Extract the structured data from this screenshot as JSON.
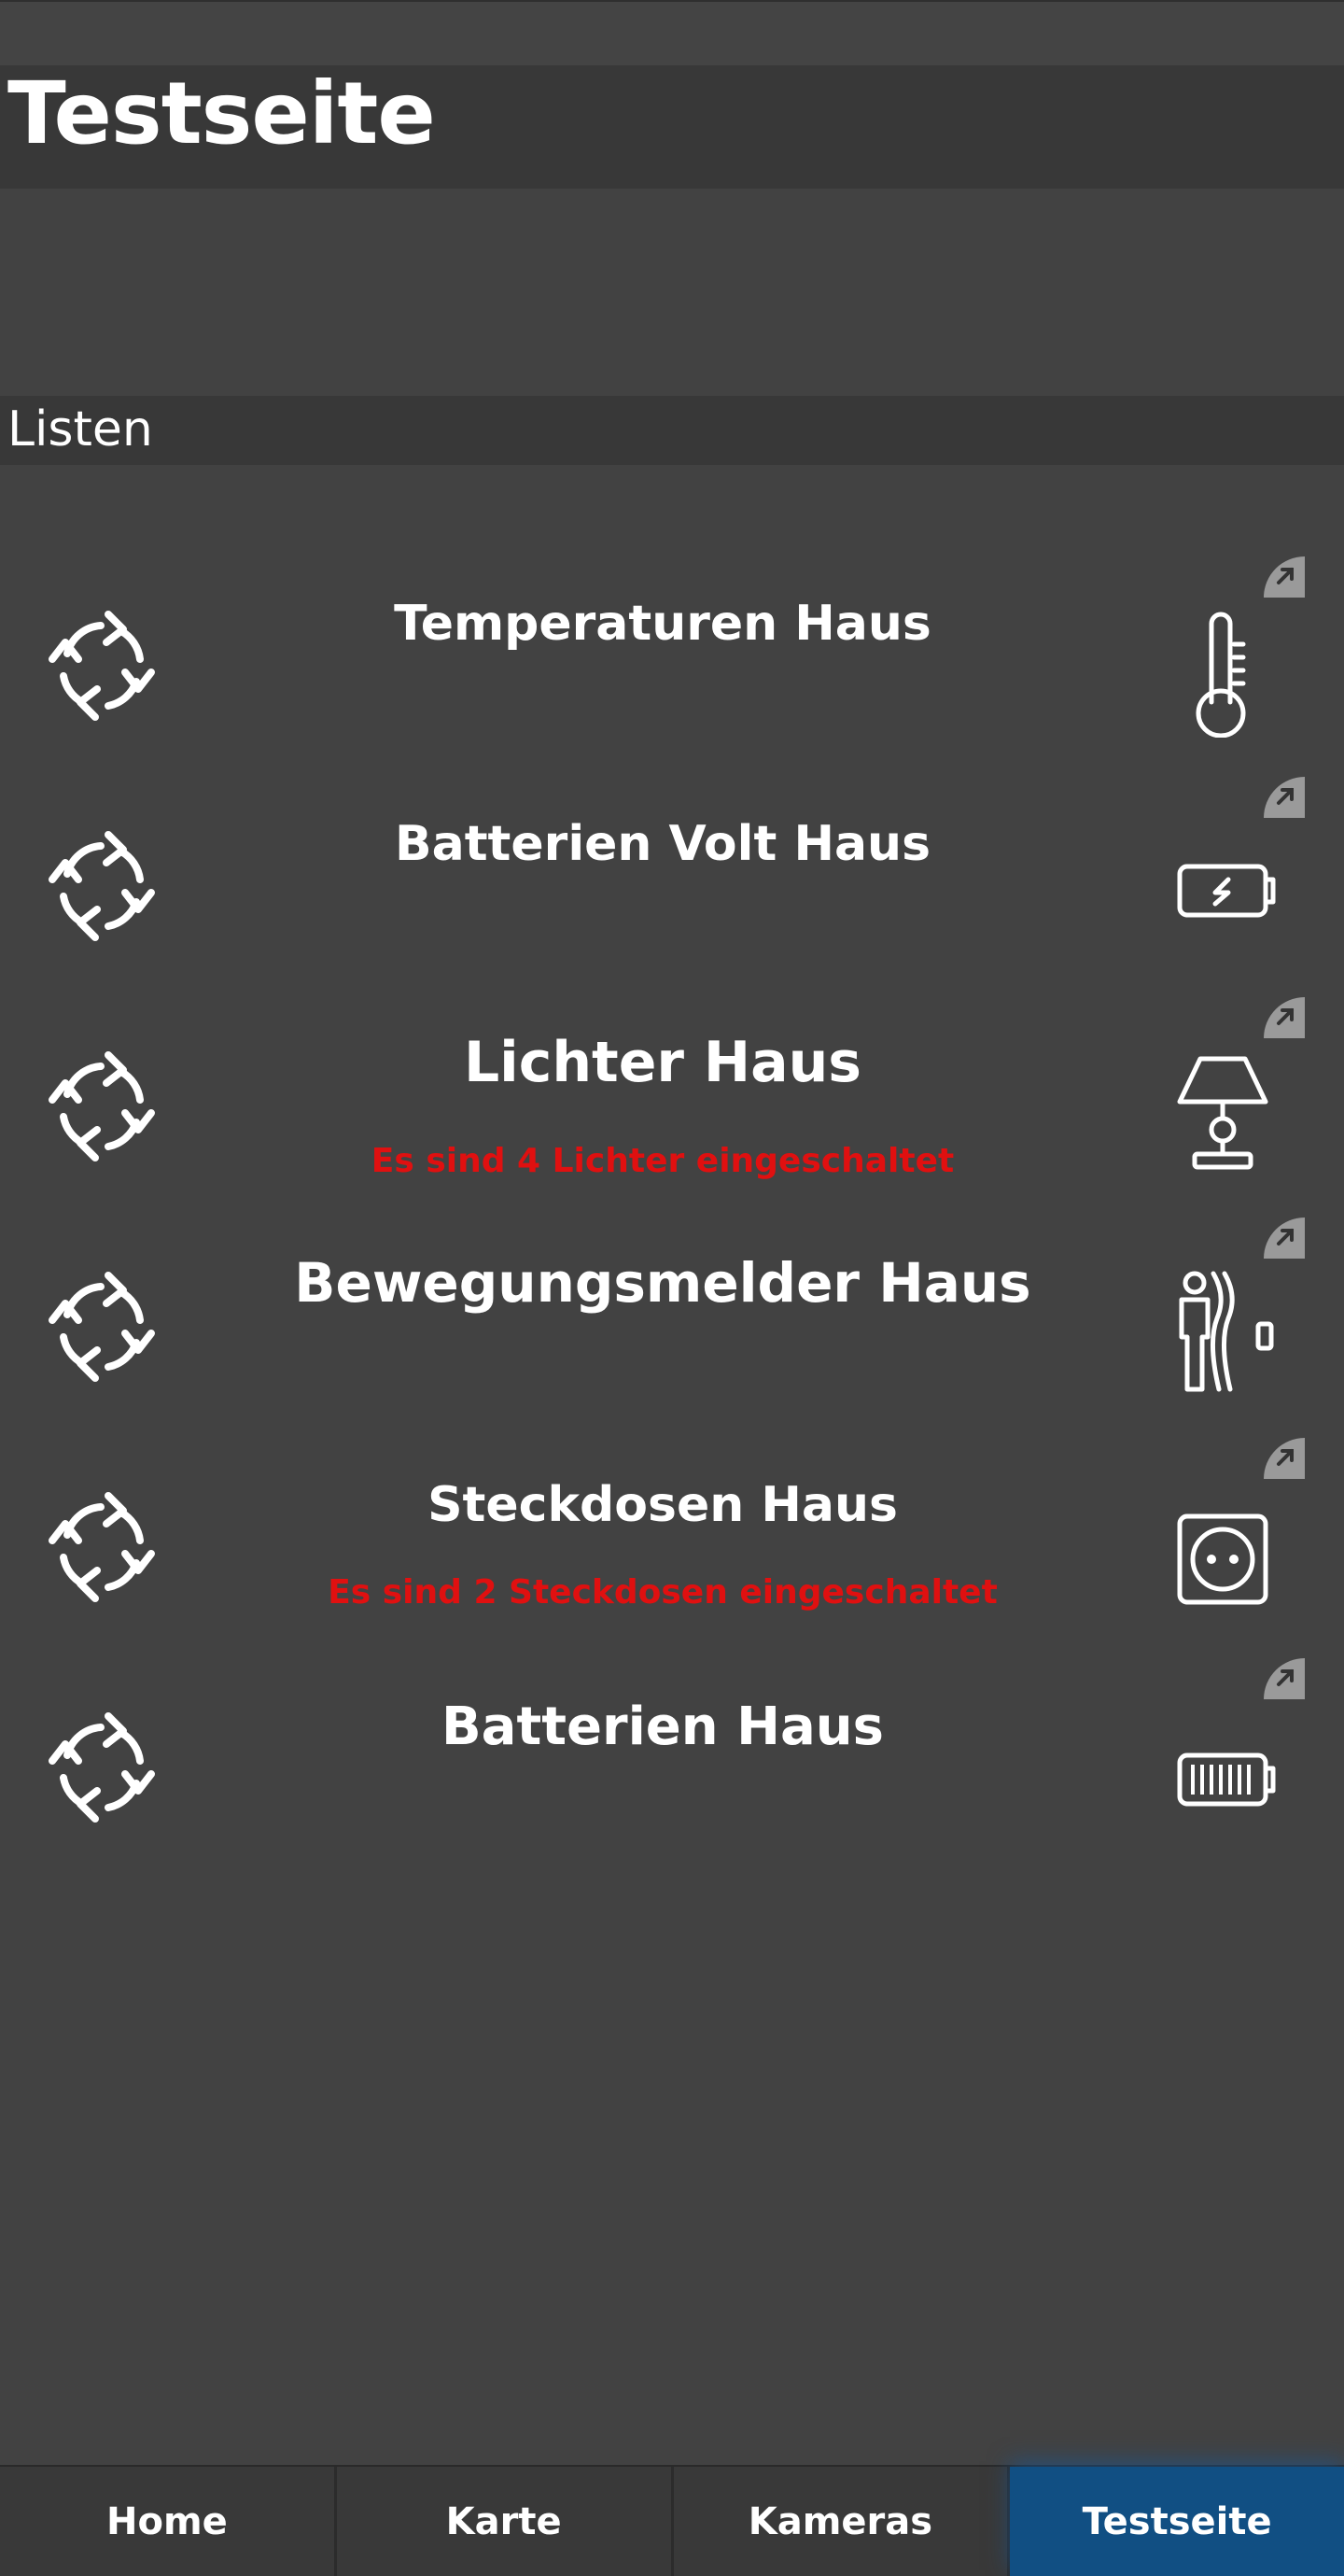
{
  "header": {
    "title": "Testseite"
  },
  "section": {
    "title": "Listen"
  },
  "colors": {
    "background": "#424242",
    "bar": "#383838",
    "accent_tab": "#114f83",
    "alert_text": "#e01010"
  },
  "rows": [
    {
      "title": "Temperaturen Haus",
      "subtitle": "",
      "icon": "thermometer-icon"
    },
    {
      "title": "Batterien Volt Haus",
      "subtitle": "",
      "icon": "battery-charging-icon"
    },
    {
      "title": "Lichter Haus",
      "subtitle": "Es sind 4 Lichter eingeschaltet",
      "icon": "table-lamp-icon"
    },
    {
      "title": "Bewegungsmelder Haus",
      "subtitle": "",
      "icon": "motion-sensor-icon"
    },
    {
      "title": "Steckdosen Haus",
      "subtitle": "Es sind 2 Steckdosen eingeschaltet",
      "icon": "power-socket-icon"
    },
    {
      "title": "Batterien Haus",
      "subtitle": "",
      "icon": "battery-full-icon"
    }
  ],
  "tabs": [
    {
      "label": "Home",
      "active": false
    },
    {
      "label": "Karte",
      "active": false
    },
    {
      "label": "Kameras",
      "active": false
    },
    {
      "label": "Testseite",
      "active": true
    }
  ]
}
